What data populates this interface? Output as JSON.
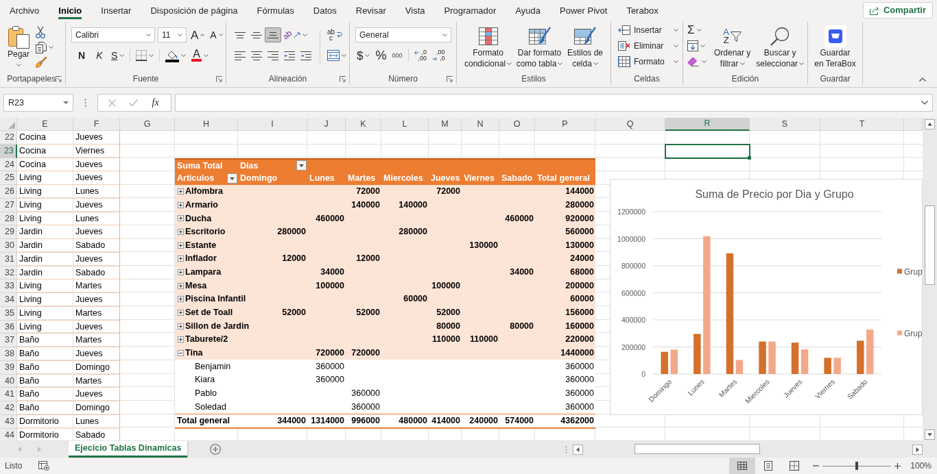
{
  "menu": {
    "tabs": [
      {
        "label": "Archivo",
        "selected": false
      },
      {
        "label": "Inicio",
        "selected": true
      },
      {
        "label": "Insertar",
        "selected": false
      },
      {
        "label": "Disposición de página",
        "selected": false
      },
      {
        "label": "Fórmulas",
        "selected": false
      },
      {
        "label": "Datos",
        "selected": false
      },
      {
        "label": "Revisar",
        "selected": false
      },
      {
        "label": "Vista",
        "selected": false
      },
      {
        "label": "Programador",
        "selected": false
      },
      {
        "label": "Ayuda",
        "selected": false
      },
      {
        "label": "Power Pivot",
        "selected": false
      },
      {
        "label": "Terabox",
        "selected": false
      }
    ],
    "share_button": "Compartir"
  },
  "ribbon": {
    "groups": [
      {
        "kind": "clipboard",
        "title": "Portapapeles",
        "launcher": true,
        "paste": "Pegar"
      },
      {
        "kind": "font",
        "title": "Fuente",
        "launcher": true,
        "font": "Calibri",
        "size": "11",
        "grow": "A",
        "shrink": "A",
        "styles": [
          {
            "kind": "bold",
            "glyph": "N"
          },
          {
            "kind": "italic",
            "glyph": "K"
          },
          {
            "kind": "underline",
            "glyph": "S"
          }
        ],
        "font_color": "A"
      },
      {
        "kind": "alignment",
        "title": "Alineación",
        "launcher": true,
        "vertical": [
          {
            "kind": "top",
            "selected": false
          },
          {
            "kind": "middle",
            "selected": false
          },
          {
            "kind": "bottom",
            "selected": true
          }
        ],
        "orientation": "ab",
        "wrap": [
          "ab",
          "c"
        ]
      },
      {
        "kind": "number",
        "title": "Número",
        "launcher": true,
        "format": "General",
        "currency": "$",
        "percent": "%",
        "thousands": "000",
        "decrease_decimals": [
          ",0",
          ",00"
        ],
        "increase_decimals": [
          ",00",
          ",0"
        ]
      },
      {
        "kind": "styles",
        "title": "Estilos",
        "buttons": [
          {
            "kind": "conditional",
            "lines": [
              "Formato",
              "condicional"
            ]
          },
          {
            "kind": "table",
            "lines": [
              "Dar formato",
              "como tabla"
            ]
          },
          {
            "kind": "cell_styles",
            "lines": [
              "Estilos de",
              "celda"
            ]
          }
        ]
      },
      {
        "kind": "cells",
        "title": "Celdas",
        "buttons": [
          {
            "kind": "insert",
            "label": "Insertar"
          },
          {
            "kind": "delete",
            "label": "Eliminar"
          },
          {
            "kind": "format",
            "label": "Formato"
          }
        ]
      },
      {
        "kind": "editing",
        "title": "Edición",
        "sum": "Σ",
        "buttons": [
          {
            "kind": "sort",
            "glyphs": [
              "A",
              "Z"
            ],
            "lines": [
              "Ordenar y",
              "filtrar"
            ]
          },
          {
            "kind": "find",
            "lines": [
              "Buscar y",
              "seleccionar"
            ]
          }
        ]
      },
      {
        "kind": "save",
        "title": "Guardar",
        "lines": [
          "Guardar",
          "en TeraBox"
        ]
      }
    ]
  },
  "formula_bar": {
    "name_box": "R23",
    "function": "fx"
  },
  "sheet": {
    "columns": [
      {
        "label": "E",
        "selected": false
      },
      {
        "label": "F",
        "selected": false
      },
      {
        "label": "G",
        "selected": false
      },
      {
        "label": "H",
        "selected": false
      },
      {
        "label": "I",
        "selected": false
      },
      {
        "label": "J",
        "selected": false
      },
      {
        "label": "K",
        "selected": false
      },
      {
        "label": "L",
        "selected": false
      },
      {
        "label": "M",
        "selected": false
      },
      {
        "label": "N",
        "selected": false
      },
      {
        "label": "O",
        "selected": false
      },
      {
        "label": "P",
        "selected": false
      },
      {
        "label": "Q",
        "selected": false
      },
      {
        "label": "R",
        "selected": true
      },
      {
        "label": "S",
        "selected": false
      },
      {
        "label": "T",
        "selected": false
      }
    ],
    "rows": [
      {
        "number": "22",
        "selected": false,
        "cells": [
          "Cocina",
          "Jueves"
        ]
      },
      {
        "number": "23",
        "selected": true,
        "cells": [
          "Cocina",
          "Viernes"
        ]
      },
      {
        "number": "24",
        "selected": false,
        "cells": [
          "Cocina",
          "Jueves"
        ]
      },
      {
        "number": "25",
        "selected": false,
        "cells": [
          "Living",
          "Jueves"
        ]
      },
      {
        "number": "26",
        "selected": false,
        "cells": [
          "Living",
          "Lunes"
        ]
      },
      {
        "number": "27",
        "selected": false,
        "cells": [
          "Living",
          "Jueves"
        ]
      },
      {
        "number": "28",
        "selected": false,
        "cells": [
          "Living",
          "Lunes"
        ]
      },
      {
        "number": "29",
        "selected": false,
        "cells": [
          "Jardin",
          "Jueves"
        ]
      },
      {
        "number": "30",
        "selected": false,
        "cells": [
          "Jardin",
          "Sabado"
        ]
      },
      {
        "number": "31",
        "selected": false,
        "cells": [
          "Jardin",
          "Jueves"
        ]
      },
      {
        "number": "32",
        "selected": false,
        "cells": [
          "Jardin",
          "Sabado"
        ]
      },
      {
        "number": "33",
        "selected": false,
        "cells": [
          "Living",
          "Martes"
        ]
      },
      {
        "number": "34",
        "selected": false,
        "cells": [
          "Living",
          "Jueves"
        ]
      },
      {
        "number": "35",
        "selected": false,
        "cells": [
          "Living",
          "Martes"
        ]
      },
      {
        "number": "36",
        "selected": false,
        "cells": [
          "Living",
          "Jueves"
        ]
      },
      {
        "number": "37",
        "selected": false,
        "cells": [
          "Baño",
          "Martes"
        ]
      },
      {
        "number": "38",
        "selected": false,
        "cells": [
          "Baño",
          "Jueves"
        ]
      },
      {
        "number": "39",
        "selected": false,
        "cells": [
          "Baño",
          "Domingo"
        ]
      },
      {
        "number": "40",
        "selected": false,
        "cells": [
          "Baño",
          "Martes"
        ]
      },
      {
        "number": "41",
        "selected": false,
        "cells": [
          "Baño",
          "Jueves"
        ]
      },
      {
        "number": "42",
        "selected": false,
        "cells": [
          "Baño",
          "Domingo"
        ]
      },
      {
        "number": "43",
        "selected": false,
        "cells": [
          "Dormitorio",
          "Lunes"
        ]
      },
      {
        "number": "44",
        "selected": false,
        "cells": [
          "Dormitorio",
          "Sabado"
        ]
      }
    ],
    "pivot": {
      "value_field": "Suma Total",
      "column_field": "Dias",
      "row_field": "Articulos",
      "columns": {
        "domingo": "Domingo",
        "lunes": "Lunes",
        "martes": "Martes",
        "miercoles": "Miercoles",
        "jueves": "Jueves",
        "viernes": "Viernes",
        "sabado": "Sabado",
        "total_general": "Total general"
      },
      "rows": [
        {
          "label": "Alfombra",
          "expanded": false,
          "values": {
            "martes": "72000",
            "jueves": "72000",
            "total_general": "144000"
          }
        },
        {
          "label": "Armario",
          "expanded": false,
          "values": {
            "martes": "140000",
            "miercoles": "140000",
            "total_general": "280000"
          }
        },
        {
          "label": "Ducha",
          "expanded": false,
          "values": {
            "lunes": "460000",
            "sabado": "460000",
            "total_general": "920000"
          }
        },
        {
          "label": "Escritorio",
          "expanded": false,
          "values": {
            "domingo": "280000",
            "miercoles": "280000",
            "total_general": "560000"
          }
        },
        {
          "label": "Estante",
          "expanded": false,
          "values": {
            "viernes": "130000",
            "total_general": "130000"
          }
        },
        {
          "label": "Inflador",
          "expanded": false,
          "values": {
            "domingo": "12000",
            "martes": "12000",
            "total_general": "24000"
          }
        },
        {
          "label": "Lampara",
          "expanded": false,
          "values": {
            "lunes": "34000",
            "sabado": "34000",
            "total_general": "68000"
          }
        },
        {
          "label": "Mesa",
          "expanded": false,
          "values": {
            "lunes": "100000",
            "jueves": "100000",
            "total_general": "200000"
          }
        },
        {
          "label": "Piscina Infantil",
          "expanded": false,
          "values": {
            "miercoles": "60000",
            "total_general": "60000"
          }
        },
        {
          "label": "Set de Toall",
          "expanded": false,
          "values": {
            "domingo": "52000",
            "martes": "52000",
            "jueves": "52000",
            "total_general": "156000"
          }
        },
        {
          "label": "Sillon de Jardin",
          "expanded": false,
          "values": {
            "jueves": "80000",
            "sabado": "80000",
            "total_general": "160000"
          }
        },
        {
          "label": "Taburete/2",
          "expanded": false,
          "values": {
            "jueves": "110000",
            "viernes": "110000",
            "total_general": "220000"
          }
        },
        {
          "label": "Tina",
          "expanded": true,
          "values": {
            "lunes": "720000",
            "martes": "720000",
            "total_general": "1440000"
          },
          "children": [
            {
              "label": "Benjamin",
              "values": {
                "lunes": "360000",
                "total_general": "360000"
              }
            },
            {
              "label": "Kiara",
              "values": {
                "lunes": "360000",
                "total_general": "360000"
              }
            },
            {
              "label": "Pablo",
              "values": {
                "martes": "360000",
                "total_general": "360000"
              }
            },
            {
              "label": "Soledad",
              "values": {
                "martes": "360000",
                "total_general": "360000"
              }
            }
          ]
        }
      ],
      "total": {
        "label": "Total general",
        "values": {
          "domingo": "344000",
          "lunes": "1314000",
          "martes": "996000",
          "miercoles": "480000",
          "jueves": "414000",
          "viernes": "240000",
          "sabado": "574000",
          "total_general": "4362000"
        }
      }
    },
    "chart": {
      "title": "Suma de Precio por Dia y Grupo",
      "chart_data": {
        "type": "bar",
        "categories": [
          "Domingo",
          "Lunes",
          "Martes",
          "Miercoles",
          "Jueves",
          "Viernes",
          "Sabado"
        ],
        "series": [
          {
            "name": "Grup",
            "color": "#d4702c",
            "values": [
              164000,
              296000,
              892000,
              240000,
              232000,
              120000,
              246000
            ]
          },
          {
            "name": "Grup",
            "color": "#f2a98a",
            "values": [
              180000,
              1018000,
              104000,
              240000,
              182000,
              120000,
              328000
            ]
          }
        ],
        "ylim": [
          0,
          1200000
        ],
        "yticks": [
          0,
          200000,
          400000,
          600000,
          800000,
          1000000,
          1200000
        ],
        "grid": true
      }
    }
  },
  "sheet_tabs": [
    {
      "label": "Ejecicio Tablas Dinamicas",
      "selected": true
    }
  ],
  "status_bar": {
    "status": "Listo",
    "views": [
      {
        "kind": "normal",
        "selected": true
      },
      {
        "kind": "page_layout",
        "selected": false
      },
      {
        "kind": "page_break",
        "selected": false
      }
    ],
    "zoom": {
      "level": 0.5,
      "reading": "100%"
    }
  }
}
